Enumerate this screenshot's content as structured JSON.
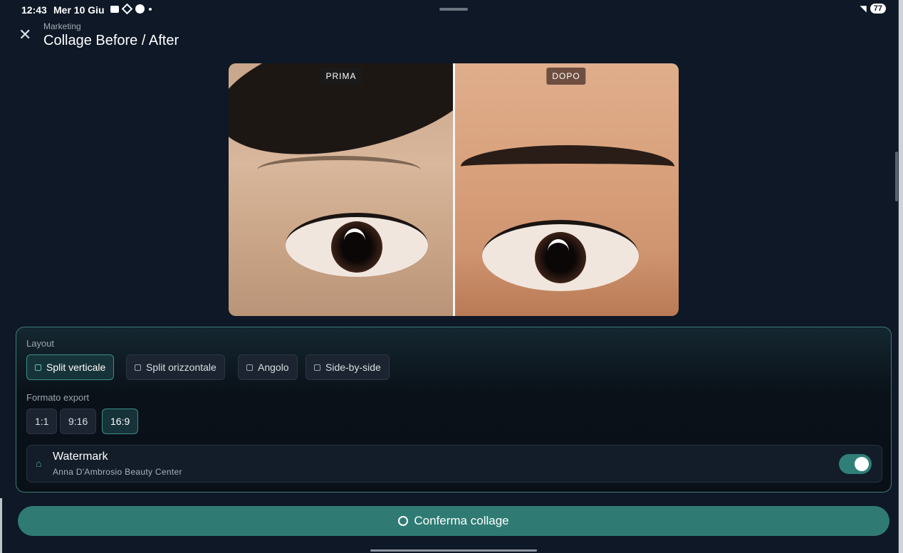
{
  "status_bar": {
    "time": "12:43",
    "date": "Mer 10 Giu",
    "battery": "77"
  },
  "header": {
    "section": "Marketing",
    "title": "Collage Before / After"
  },
  "collage": {
    "before_label": "PRIMA",
    "after_label": "DOPO"
  },
  "options": {
    "layout_label": "Layout",
    "layouts": [
      {
        "label": "Split verticale",
        "active": true
      },
      {
        "label": "Split orizzontale",
        "active": false
      },
      {
        "label": "Angolo",
        "active": false
      },
      {
        "label": "Side-by-side",
        "active": false
      }
    ],
    "format_label": "Formato export",
    "formats": [
      {
        "label": "1:1",
        "active": false
      },
      {
        "label": "9:16",
        "active": false
      },
      {
        "label": "16:9",
        "active": true
      }
    ],
    "watermark": {
      "title": "Watermark",
      "subtitle": "Anna D'Ambrosio Beauty Center",
      "enabled": true
    }
  },
  "confirm_label": "Conferma collage",
  "colors": {
    "accent": "#2f7b74",
    "background": "#0e1826",
    "panel_border": "#3d7c77"
  }
}
